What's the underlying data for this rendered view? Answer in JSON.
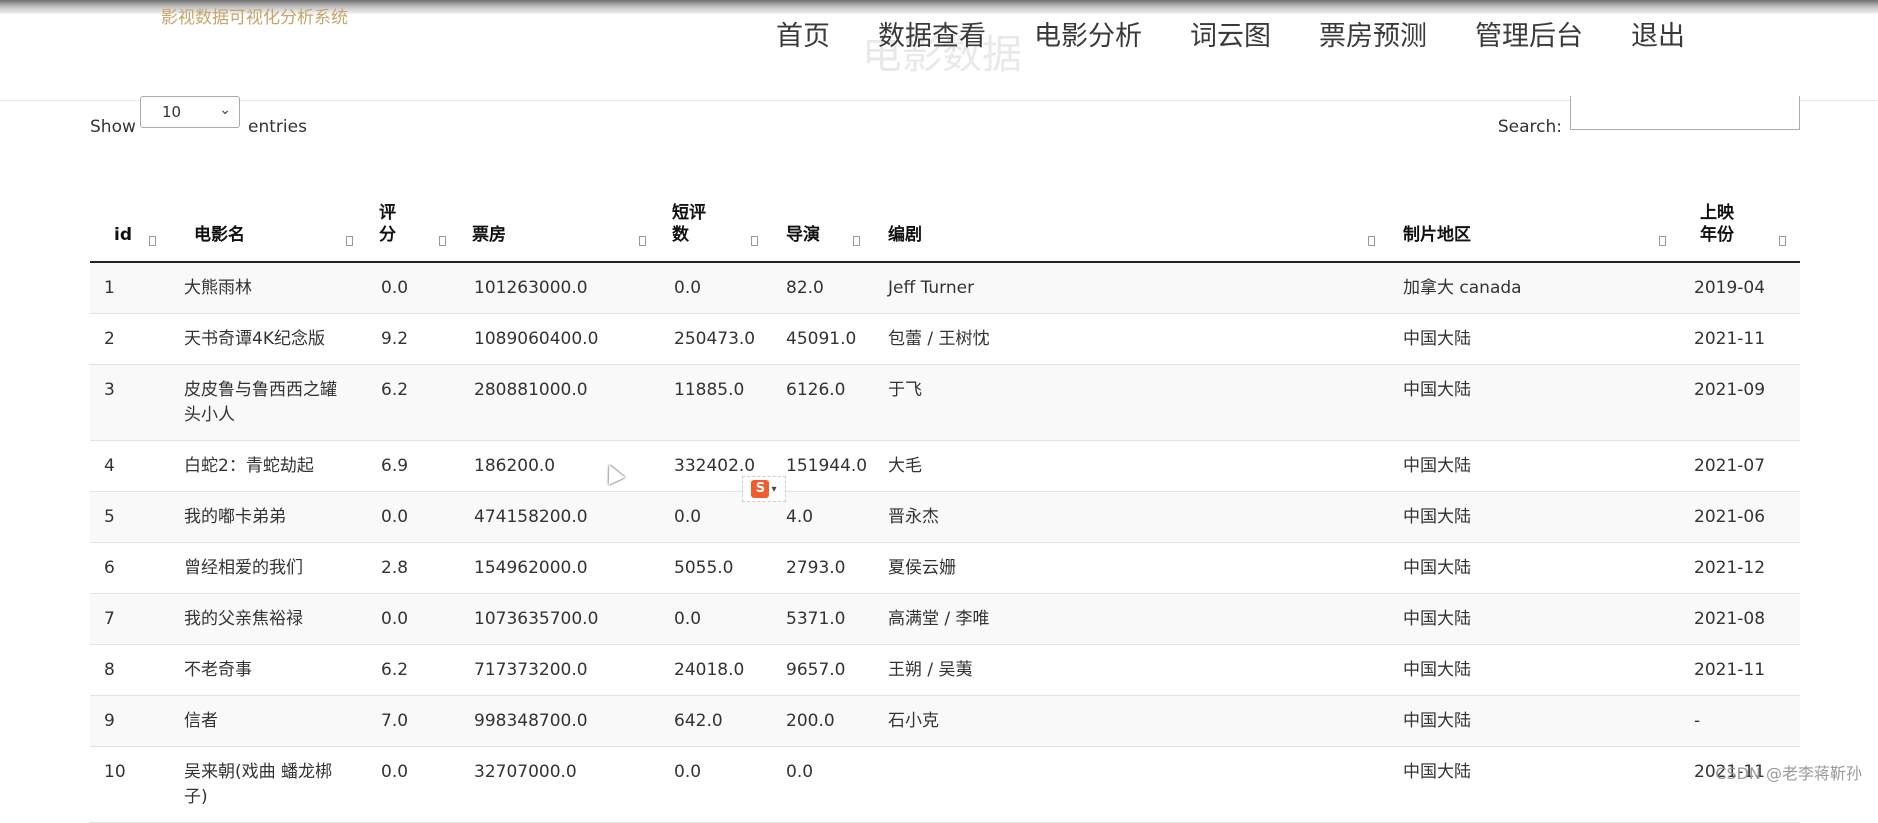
{
  "header": {
    "brand": "影视数据可视化分析系统",
    "ghost_title": "电影数据",
    "nav": [
      "首页",
      "数据查看",
      "电影分析",
      "词云图",
      "票房预测",
      "管理后台",
      "退出"
    ]
  },
  "controls": {
    "show_label": "Show",
    "page_length": "10",
    "entries_label": "entries",
    "search_label": "Search:",
    "search_value": ""
  },
  "table": {
    "columns": [
      "id",
      "电影名",
      "评分",
      "票房",
      "短评数",
      "导演",
      "编剧",
      "制片地区",
      "上映年份"
    ],
    "rows": [
      [
        "1",
        "大熊雨林",
        "0.0",
        "101263000.0",
        "0.0",
        "82.0",
        "Jeff Turner",
        "加拿大 canada",
        "2019-04"
      ],
      [
        "2",
        "天书奇谭4K纪念版",
        "9.2",
        "1089060400.0",
        "250473.0",
        "45091.0",
        "包蕾 / 王树忱",
        "中国大陆",
        "2021-11"
      ],
      [
        "3",
        "皮皮鲁与鲁西西之罐头小人",
        "6.2",
        "280881000.0",
        "11885.0",
        "6126.0",
        "于飞",
        "中国大陆",
        "2021-09"
      ],
      [
        "4",
        "白蛇2：青蛇劫起",
        "6.9",
        "186200.0",
        "332402.0",
        "151944.0",
        "大毛",
        "中国大陆",
        "2021-07"
      ],
      [
        "5",
        "我的嘟卡弟弟",
        "0.0",
        "474158200.0",
        "0.0",
        "4.0",
        "晋永杰",
        "中国大陆",
        "2021-06"
      ],
      [
        "6",
        "曾经相爱的我们",
        "2.8",
        "154962000.0",
        "5055.0",
        "2793.0",
        "夏侯云姗",
        "中国大陆",
        "2021-12"
      ],
      [
        "7",
        "我的父亲焦裕禄",
        "0.0",
        "1073635700.0",
        "0.0",
        "5371.0",
        "高满堂 / 李唯",
        "中国大陆",
        "2021-08"
      ],
      [
        "8",
        "不老奇事",
        "6.2",
        "717373200.0",
        "24018.0",
        "9657.0",
        "王朔 / 吴荑",
        "中国大陆",
        "2021-11"
      ],
      [
        "9",
        "信者",
        "7.0",
        "998348700.0",
        "642.0",
        "200.0",
        "石小克",
        "中国大陆",
        "-"
      ],
      [
        "10",
        "吴来朝(戏曲 蟠龙梆子)",
        "0.0",
        "32707000.0",
        "0.0",
        "0.0",
        "",
        "中国大陆",
        "2021-11"
      ]
    ]
  },
  "ime": {
    "logo": "S"
  },
  "watermark": "CSDN @老李蒋靳孙",
  "colors": {
    "brand": "#c8a46a",
    "row_stripe": "#f9f9f9",
    "ime_logo": "#ef5d2e"
  },
  "icons": {
    "select_arrow": "chevron-down-icon",
    "sort": "sort-icon",
    "ime": "sogou-ime-icon",
    "cursor": "mouse-cursor-icon"
  }
}
